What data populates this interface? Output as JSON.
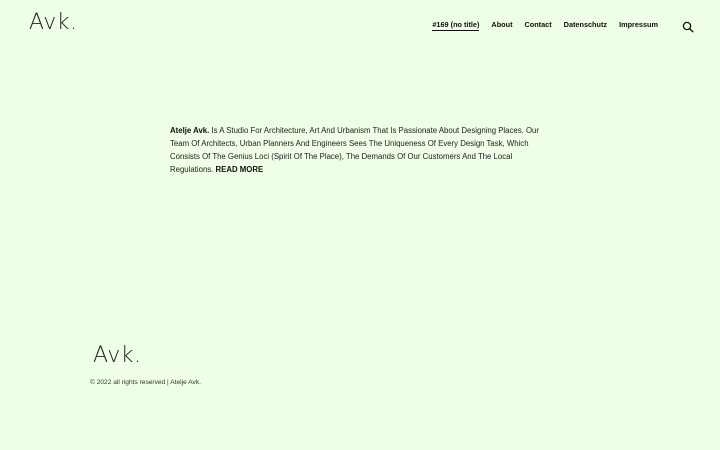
{
  "header": {
    "logo": "Avk.",
    "nav": [
      {
        "label": "#169 (no title)",
        "active": true
      },
      {
        "label": "About",
        "active": false
      },
      {
        "label": "Contact",
        "active": false
      },
      {
        "label": "Datenschutz",
        "active": false
      },
      {
        "label": "Impressum",
        "active": false
      }
    ],
    "search_icon": "search-icon"
  },
  "intro": {
    "studio_name": "Atelje Avk.",
    "text": "Is A Studio For Architecture, Art And Urbanism That Is Passionate About Designing Places. Our Team Of Architects, Urban Planners And Engineers Sees The Uniqueness Of Every Design Task, Which Consists Of The Genius Loci (Spirit Of The Place), The Demands Of Our Customers And The Local Regulations.",
    "read_more": "READ MORE"
  },
  "footer": {
    "logo": "Avk.",
    "copyright": "© 2022 all rights reserved | Atelje Avk."
  },
  "colors": {
    "background": "#effee6",
    "text": "#1a1a1a"
  }
}
